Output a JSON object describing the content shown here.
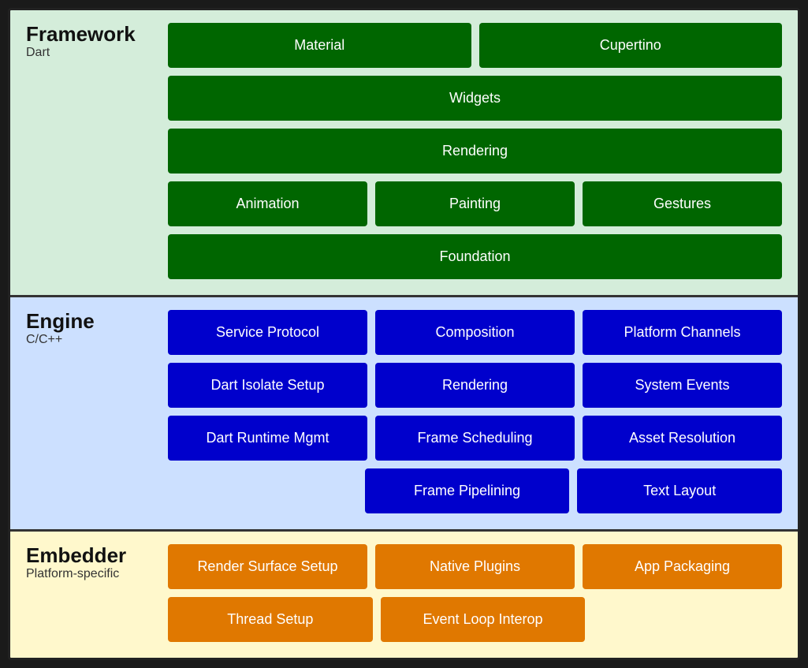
{
  "framework": {
    "title": "Framework",
    "subtitle": "Dart",
    "rows": [
      [
        {
          "label": "Material",
          "span": 1
        },
        {
          "label": "Cupertino",
          "span": 1
        }
      ],
      [
        {
          "label": "Widgets",
          "span": 2
        }
      ],
      [
        {
          "label": "Rendering",
          "span": 2
        }
      ],
      [
        {
          "label": "Animation",
          "span": 1
        },
        {
          "label": "Painting",
          "span": 1
        },
        {
          "label": "Gestures",
          "span": 1
        }
      ],
      [
        {
          "label": "Foundation",
          "span": 2
        }
      ]
    ]
  },
  "engine": {
    "title": "Engine",
    "subtitle": "C/C++",
    "rows": [
      [
        {
          "label": "Service Protocol"
        },
        {
          "label": "Composition"
        },
        {
          "label": "Platform Channels"
        }
      ],
      [
        {
          "label": "Dart Isolate Setup"
        },
        {
          "label": "Rendering"
        },
        {
          "label": "System Events"
        }
      ],
      [
        {
          "label": "Dart Runtime Mgmt"
        },
        {
          "label": "Frame Scheduling"
        },
        {
          "label": "Asset Resolution"
        }
      ],
      [
        {
          "label": ""
        },
        {
          "label": "Frame Pipelining"
        },
        {
          "label": "Text Layout"
        }
      ]
    ]
  },
  "embedder": {
    "title": "Embedder",
    "subtitle": "Platform-specific",
    "rows": [
      [
        {
          "label": "Render Surface Setup"
        },
        {
          "label": "Native Plugins"
        },
        {
          "label": "App Packaging"
        }
      ],
      [
        {
          "label": "Thread Setup"
        },
        {
          "label": "Event Loop Interop"
        },
        {
          "label": ""
        }
      ]
    ]
  }
}
